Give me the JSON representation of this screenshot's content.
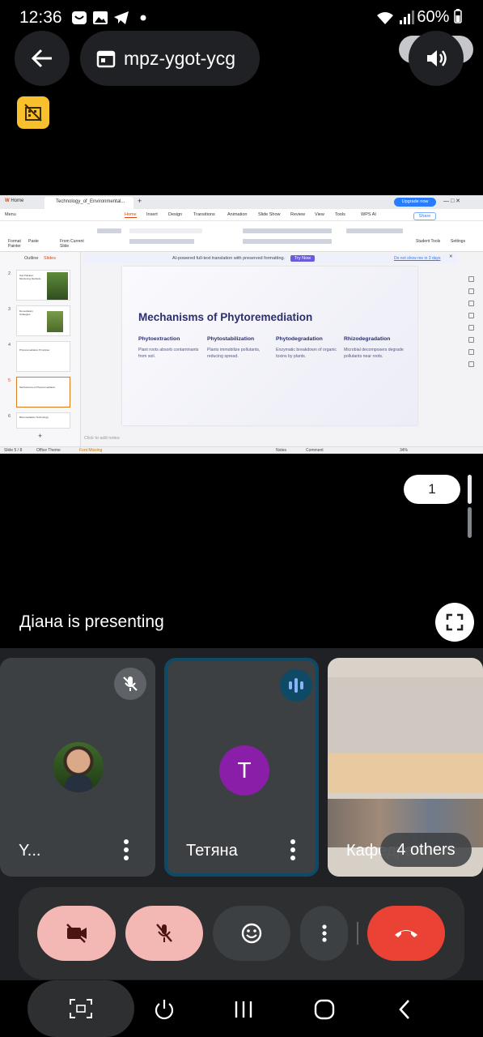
{
  "status_bar": {
    "time": "12:36",
    "battery": "60%"
  },
  "meeting": {
    "code": "mpz-ygot-ycg"
  },
  "presentation": {
    "app_tabs": {
      "home": "Home",
      "document": "Technology_of_Environmental..."
    },
    "upgrade_label": "Upgrade now",
    "menu": [
      "Menu",
      "Home",
      "Insert",
      "Design",
      "Transitions",
      "Animation",
      "Slide Show",
      "Review",
      "View",
      "Tools",
      "WPS AI"
    ],
    "share_label": "Share",
    "ribbon": {
      "format_painter": "Format Painter",
      "paste": "Paste",
      "from_current_slide": "From Current Slide",
      "student_tools": "Student Tools",
      "settings": "Settings"
    },
    "panel_tabs": [
      "Outline",
      "Slides"
    ],
    "thumbnails": [
      {
        "num": "2",
        "title": "Soil Pollution Monitoring Methods"
      },
      {
        "num": "3",
        "title": "Remediation Strategies"
      },
      {
        "num": "4",
        "title": "Phytoremediation Principles"
      },
      {
        "num": "5",
        "title": "Mechanisms of Phytoremediation"
      },
      {
        "num": "6",
        "title": "Bioremediation Technology"
      }
    ],
    "banner": {
      "text": "AI-powered full-text translation with preserved formatting.",
      "try": "Try Now",
      "dismiss": "Do not show me in 3 days"
    },
    "slide": {
      "title": "Mechanisms of Phytoremediation",
      "columns": [
        {
          "heading": "Phytoextraction",
          "body": "Plant roots absorb contaminants from soil."
        },
        {
          "heading": "Phytostabilization",
          "body": "Plants immobilize pollutants, reducing spread."
        },
        {
          "heading": "Phytodegradation",
          "body": "Enzymatic breakdown of organic toxins by plants."
        },
        {
          "heading": "Rhizodegradation",
          "body": "Microbial decomposers degrade pollutants near roots."
        }
      ]
    },
    "notes_placeholder": "Click to add notes",
    "status": {
      "slide": "Slide 5 / 8",
      "theme": "Office Theme",
      "font": "Font Missing",
      "notes": "Notes",
      "comment": "Comment",
      "zoom": "34%"
    }
  },
  "page_counter": "1",
  "presenting_text": "Діана is presenting",
  "participants": [
    {
      "name": "Y...",
      "muted": true
    },
    {
      "name": "Тетяна",
      "initial": "T",
      "speaking": true
    },
    {
      "name": "Кафедра",
      "others": "4 others"
    }
  ],
  "colors": {
    "end_call": "#ea4335",
    "muted_bg": "#f4b8b4",
    "avatar_t": "#8a1ea8",
    "badge": "#f9c02e"
  }
}
